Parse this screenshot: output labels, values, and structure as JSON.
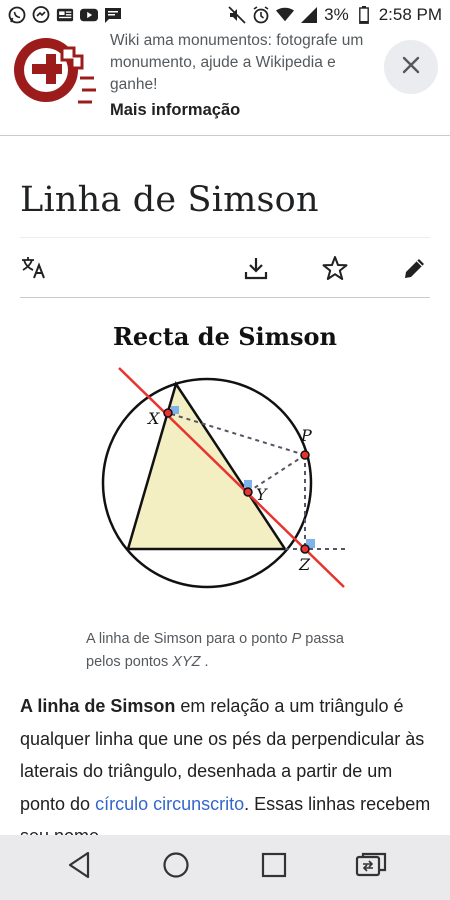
{
  "status_bar": {
    "left_icons": [
      "whatsapp-icon",
      "messenger-icon",
      "news-icon",
      "youtube-icon",
      "message-icon"
    ],
    "battery_percent": "3%",
    "time": "2:58 PM"
  },
  "banner": {
    "text": "Wiki ama monumentos: fotografe um monumento, ajude a Wikipedia e ganhe!",
    "link": "Mais informação"
  },
  "page": {
    "title": "Linha de Simson"
  },
  "toolbar": {
    "icons": [
      "translate-icon",
      "download-icon",
      "star-icon",
      "edit-icon"
    ]
  },
  "figure": {
    "title": "Recta de Simson",
    "labels": {
      "x": "X",
      "y": "Y",
      "z": "Z",
      "p": "P"
    },
    "caption_prefix": "A linha de Simson para o ponto ",
    "caption_p": "P",
    "caption_mid": " passa pelos pontos ",
    "caption_xyz": "XYZ",
    "caption_end": " ."
  },
  "article": {
    "bold_lead": "A linha de Simson",
    "text1": " em relação a um triângulo é qualquer linha que une os pés da perpendicular às laterais do triângulo, desenhada a partir de um ponto do ",
    "link1": "círculo circunscrito",
    "text2": ". Essas linhas recebem seu nome"
  },
  "colors": {
    "accent_link": "#3366cc",
    "triangle_fill": "#f3efc3",
    "simson_line": "#e8332e",
    "nav_bar": "#eaeaec"
  }
}
